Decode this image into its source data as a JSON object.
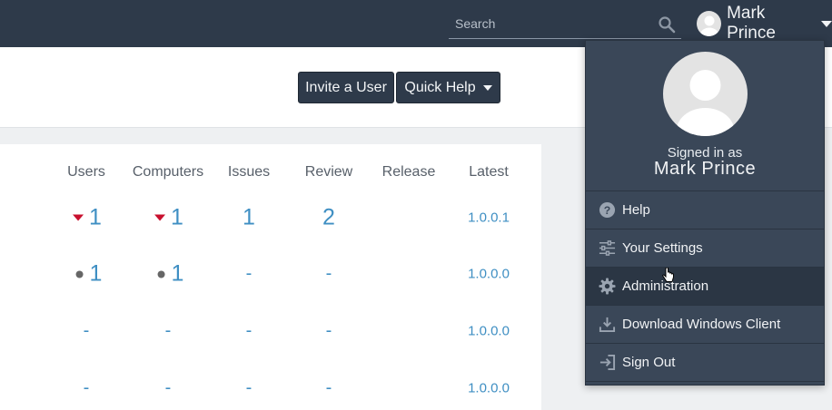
{
  "topbar": {
    "search_placeholder": "Search",
    "user_name": "Mark Prince"
  },
  "actions": {
    "invite_label": "Invite a User",
    "quick_help_label": "Quick Help"
  },
  "table": {
    "columns": [
      "Users",
      "Computers",
      "Issues",
      "Review",
      "Release",
      "Latest"
    ],
    "rows": [
      {
        "users": "1",
        "users_marker": "down-triangle",
        "computers": "1",
        "computers_marker": "down-triangle",
        "issues": "1",
        "review": "2",
        "release": "",
        "latest": "1.0.0.1"
      },
      {
        "users": "1",
        "users_marker": "dot",
        "computers": "1",
        "computers_marker": "dot",
        "issues": "-",
        "review": "-",
        "release": "",
        "latest": "1.0.0.0"
      },
      {
        "users": "-",
        "computers": "-",
        "issues": "-",
        "review": "-",
        "release": "",
        "latest": "1.0.0.0"
      },
      {
        "users": "-",
        "computers": "-",
        "issues": "-",
        "review": "-",
        "release": "",
        "latest": "1.0.0.0"
      }
    ]
  },
  "menu": {
    "signed_in_label": "Signed in as",
    "user_name": "Mark Prince",
    "items": [
      {
        "label": "Help",
        "icon": "question-circle-icon"
      },
      {
        "label": "Your Settings",
        "icon": "sliders-icon"
      },
      {
        "label": "Administration",
        "icon": "gear-icon",
        "active": true
      },
      {
        "label": "Download Windows Client",
        "icon": "download-icon"
      },
      {
        "label": "Sign Out",
        "icon": "sign-out-icon"
      }
    ]
  },
  "colors": {
    "topbar": "#2e3a4a",
    "menu": "#3a4758",
    "link": "#3f8fc3",
    "alert": "#c8102e"
  }
}
